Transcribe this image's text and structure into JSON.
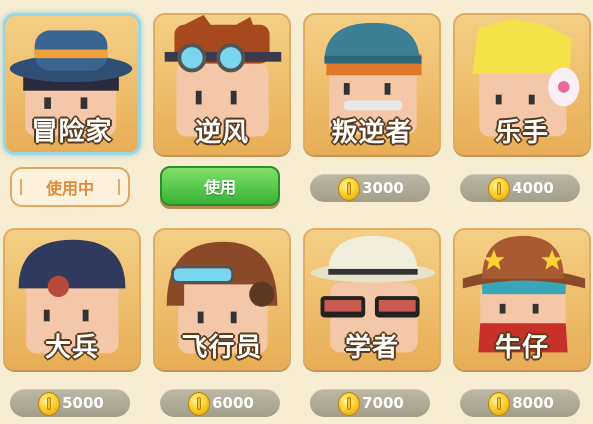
{
  "characters": [
    {
      "name": "冒险家",
      "status": "使用中"
    },
    {
      "name": "逆风",
      "button": "使用"
    },
    {
      "name": "叛逆者",
      "price": "3000"
    },
    {
      "name": "乐手",
      "price": "4000"
    },
    {
      "name": "大兵",
      "price": "5000"
    },
    {
      "name": "飞行员",
      "price": "6000"
    },
    {
      "name": "学者",
      "price": "7000"
    },
    {
      "name": "牛仔",
      "price": "8000"
    }
  ],
  "icons": {
    "currency": "gold-coin-icon"
  },
  "colors": {
    "card": "#f0c070",
    "selected_border": "#9ad6e6",
    "use_button": "#45b83c",
    "price_pill": "#b0aa98"
  }
}
